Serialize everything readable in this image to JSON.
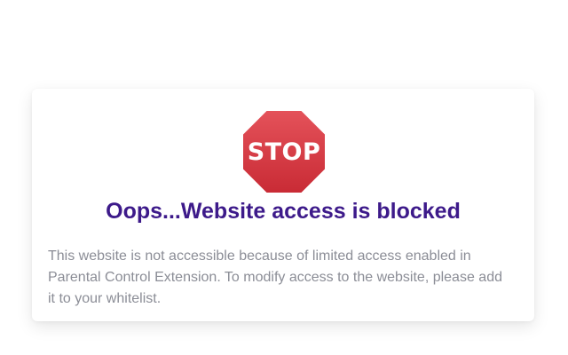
{
  "blocked_page": {
    "stop_sign": {
      "icon": "stop-sign-icon",
      "text": "STOP",
      "color": "#d8363f"
    },
    "title": "Oops...Website access is blocked",
    "title_color": "#3d1a8a",
    "message": "This website is not accessible because of limited access enabled in Parental Control Extension. To modify access to the website, please add it to your whitelist.",
    "message_color": "#8b8d96"
  }
}
